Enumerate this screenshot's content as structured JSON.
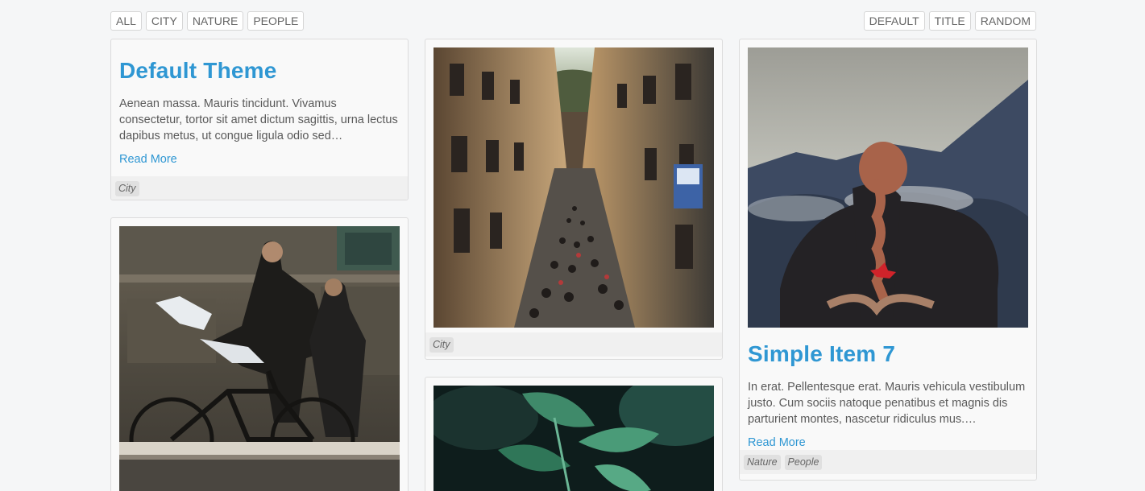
{
  "filters": {
    "left": [
      "ALL",
      "CITY",
      "NATURE",
      "PEOPLE"
    ],
    "right": [
      "DEFAULT",
      "TITLE",
      "RANDOM"
    ]
  },
  "cards": {
    "default_theme": {
      "title": "Default Theme",
      "text": "Aenean massa. Mauris tincidunt. Vivamus consectetur, tortor sit amet dictum sagittis, urna lectus dapibus metus, ut congue ligula odio sed…",
      "link": "Read More",
      "tags": [
        "City"
      ]
    },
    "city_street": {
      "tags": [
        "City"
      ]
    },
    "simple_item_7": {
      "title": "Simple Item 7",
      "text": "In erat. Pellentesque erat. Mauris vehicula vestibulum justo. Cum sociis natoque penatibus et magnis dis parturient montes, nascetur ridiculus mus.…",
      "link": "Read More",
      "tags": [
        "Nature",
        "People"
      ]
    }
  },
  "colors": {
    "accent": "#2f97d3",
    "background": "#f5f6f7"
  }
}
